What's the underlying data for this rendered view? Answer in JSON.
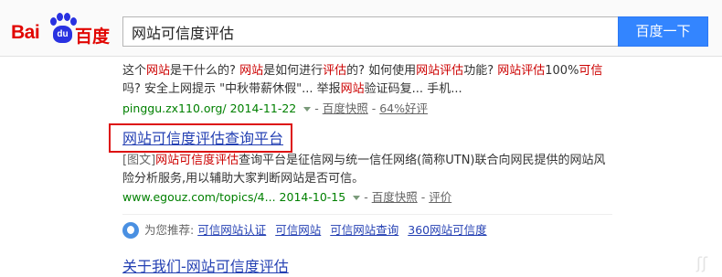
{
  "logo": {
    "text_bai": "Bai",
    "text_du": "du",
    "text_cn": "百度"
  },
  "search": {
    "query": "网站可信度评估",
    "button_label": "百度一下"
  },
  "result1": {
    "abstract_parts": [
      {
        "t": "这个",
        "em": false
      },
      {
        "t": "网站",
        "em": true
      },
      {
        "t": "是干什么的? ",
        "em": false
      },
      {
        "t": "网站",
        "em": true
      },
      {
        "t": "是如何进行",
        "em": false
      },
      {
        "t": "评估",
        "em": true
      },
      {
        "t": "的? 如何使用",
        "em": false
      },
      {
        "t": "网站评估",
        "em": true
      },
      {
        "t": "功能? ",
        "em": false
      },
      {
        "t": "网站评估",
        "em": true
      },
      {
        "t": "100%",
        "em": false
      },
      {
        "t": "可信",
        "em": true
      },
      {
        "t": "吗? 安全上网提示 \"中秋带薪休假\"... 举报",
        "em": false
      },
      {
        "t": "网站",
        "em": true
      },
      {
        "t": "验证码复... 手机...",
        "em": false
      }
    ],
    "url": "pinggu.zx110.org/",
    "date": "2014-11-22",
    "dash": "-",
    "cache_label": "百度快照",
    "rating_label": "64%好评"
  },
  "result2": {
    "title": "网站可信度评估查询平台",
    "tag": "[图文]",
    "abstract_parts": [
      {
        "t": "网站可信度评估",
        "em": true
      },
      {
        "t": "查询平台是征信网与统一信任网络(简称UTN)联合向网民提供的网站风险分析服务,用以辅助大家判断网站是否可信。",
        "em": false
      }
    ],
    "url": "www.egouz.com/topics/4...",
    "date": "2014-10-15",
    "dash": "-",
    "cache_label": "百度快照",
    "review_label": "评价"
  },
  "recommend": {
    "label": "为您推荐:",
    "items": [
      "可信网站认证",
      "可信网站",
      "可信网站查询",
      "360网站可信度"
    ]
  },
  "result3": {
    "title": "关于我们-网站可信度评估"
  },
  "colors": {
    "brand_red": "#e10602",
    "brand_blue": "#2932e1",
    "button_blue": "#3385ff",
    "link_blue": "#2440b3",
    "url_green": "#008000",
    "highlight_red": "#c00",
    "annotation_red": "#dd1111"
  }
}
